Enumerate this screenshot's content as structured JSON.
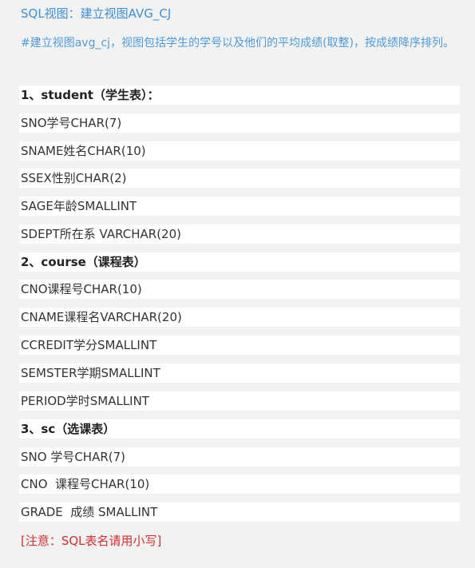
{
  "title": "SQL视图：建立视图AVG_CJ",
  "description": "#建立视图avg_cj，视图包括学生的学号以及他们的平均成绩(取整)，按成绩降序排列。",
  "tables": [
    {
      "heading": "1、student（学生表）：",
      "fields": [
        "SNO学号CHAR(7)",
        "SNAME姓名CHAR(10)",
        "SSEX性别CHAR(2)",
        "SAGE年龄SMALLINT",
        "SDEPT所在系 VARCHAR(20)"
      ]
    },
    {
      "heading": "2、course（课程表）",
      "fields": [
        "CNO课程号CHAR(10)",
        "CNAME课程名VARCHAR(20)",
        "CCREDIT学分SMALLINT",
        "SEMSTER学期SMALLINT",
        "PERIOD学时SMALLINT"
      ]
    },
    {
      "heading": "3、sc（选课表）",
      "fields": [
        "SNO 学号CHAR(7)",
        "CNO  课程号CHAR(10)",
        "GRADE  成绩 SMALLINT"
      ]
    }
  ],
  "note": "[注意：SQL表名请用小写]",
  "colors": {
    "title": "#3d8fd6",
    "description": "#4f9bd9",
    "note": "#d03030",
    "row_background": "#ffffff",
    "page_background": "#f2f2f2"
  }
}
